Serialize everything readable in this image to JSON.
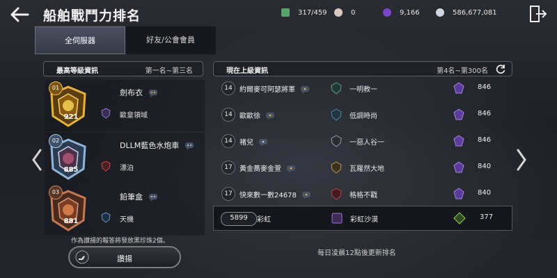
{
  "header": {
    "title": "船舶戰鬥力排名"
  },
  "resources": [
    {
      "icon": "cube-icon",
      "value": "317/459",
      "color": "#7bc47f"
    },
    {
      "icon": "pearl-icon",
      "value": "0",
      "color": "#d9c9c0"
    },
    {
      "icon": "purple-orb-icon",
      "value": "9,166",
      "color": "#8a55d6"
    },
    {
      "icon": "silver-coin-icon",
      "value": "586,677,081",
      "color": "#cfd6df"
    }
  ],
  "tabs": [
    {
      "label": "全伺服器",
      "active": true
    },
    {
      "label": "好友/公會會員",
      "active": false
    }
  ],
  "left_panel": {
    "title": "最高等級資訊",
    "range": "第一名~第三名",
    "entries": [
      {
        "rank": "01",
        "score": "921",
        "player": "劍布衣",
        "guild": "歐皇領域",
        "tier": "gold"
      },
      {
        "rank": "02",
        "score": "885",
        "player": "DLLM藍色水炮車",
        "guild": "漂泊",
        "tier": "silver"
      },
      {
        "rank": "03",
        "score": "881",
        "player": "鉛筆盒",
        "guild": "天機",
        "tier": "bronze"
      }
    ],
    "reward_note": "作為讚揚的報答將發放黑珍珠2個。",
    "reward_button": "讚揚"
  },
  "right_panel": {
    "title": "現在上級資訊",
    "range": "第4名~第300名",
    "rows": [
      {
        "level": "14",
        "name": "約爾麥可阿瑟將軍",
        "guild": "一明教一",
        "power": "846"
      },
      {
        "level": "14",
        "name": "歐歐徐",
        "guild": "低調時尚",
        "power": "846"
      },
      {
        "level": "14",
        "name": "褚兒",
        "guild": "一惡人谷一",
        "power": "846"
      },
      {
        "level": "17",
        "name": "黃金蕎麥金萱",
        "guild": "瓦羅然大地",
        "power": "840"
      },
      {
        "level": "17",
        "name": "快來數一數24678",
        "guild": "格格不戳",
        "power": "840"
      }
    ],
    "my_row": {
      "rank": "5899",
      "name": "彩虹",
      "guild": "彩虹沙漠",
      "power": "377"
    }
  },
  "update_note": "每日凌晨12點後更新排名"
}
